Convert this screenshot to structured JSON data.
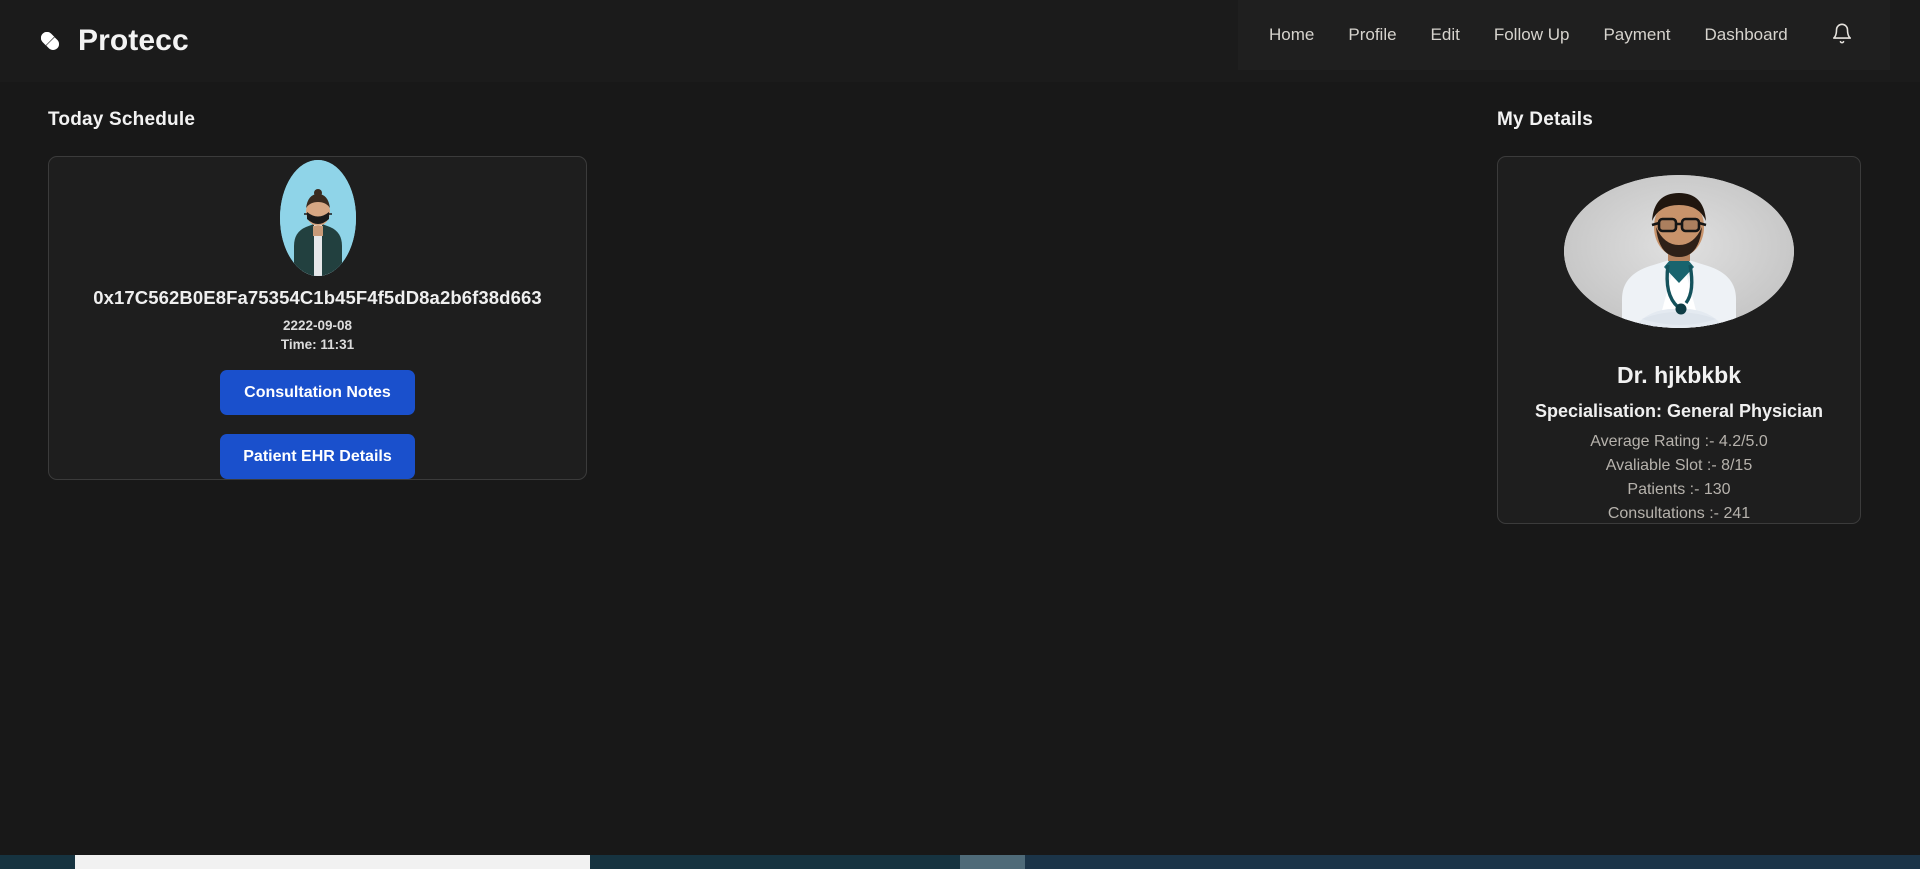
{
  "brand": {
    "name": "Protecc",
    "icon": "pill-capsule-icon"
  },
  "nav": {
    "items": [
      {
        "label": "Home"
      },
      {
        "label": "Profile"
      },
      {
        "label": "Edit"
      },
      {
        "label": "Follow Up"
      },
      {
        "label": "Payment"
      },
      {
        "label": "Dashboard"
      }
    ],
    "notification_icon": "bell-icon"
  },
  "schedule": {
    "title": "Today Schedule",
    "appointment": {
      "avatar_alt": "patient-photo-masked-person",
      "address": "0x17C562B0E8Fa75354C1b45F4f5dD8a2b6f38d663",
      "date": "2222-09-08",
      "time": "Time: 11:31",
      "buttons": {
        "consultation_notes": "Consultation Notes",
        "patient_ehr": "Patient EHR Details"
      }
    }
  },
  "my_details": {
    "title": "My Details",
    "doctor": {
      "avatar_alt": "doctor-photo-white-coat-stethoscope",
      "name": "Dr. hjkbkbk",
      "specialisation": "Specialisation: General Physician",
      "stats": [
        "Average Rating :- 4.2/5.0",
        "Avaliable Slot :- 8/15",
        "Patients :- 130",
        "Consultations :- 241"
      ]
    }
  },
  "colors": {
    "page_background": "#181818",
    "navbar_background": "#1b1b1b",
    "nav_panel_background": "#1f1f1f",
    "card_background": "#1e1e1e",
    "card_border": "#3b3b3b",
    "button_blue": "#1a50cc",
    "text_primary": "#f2f2f2",
    "text_muted": "#b6b2ac"
  }
}
